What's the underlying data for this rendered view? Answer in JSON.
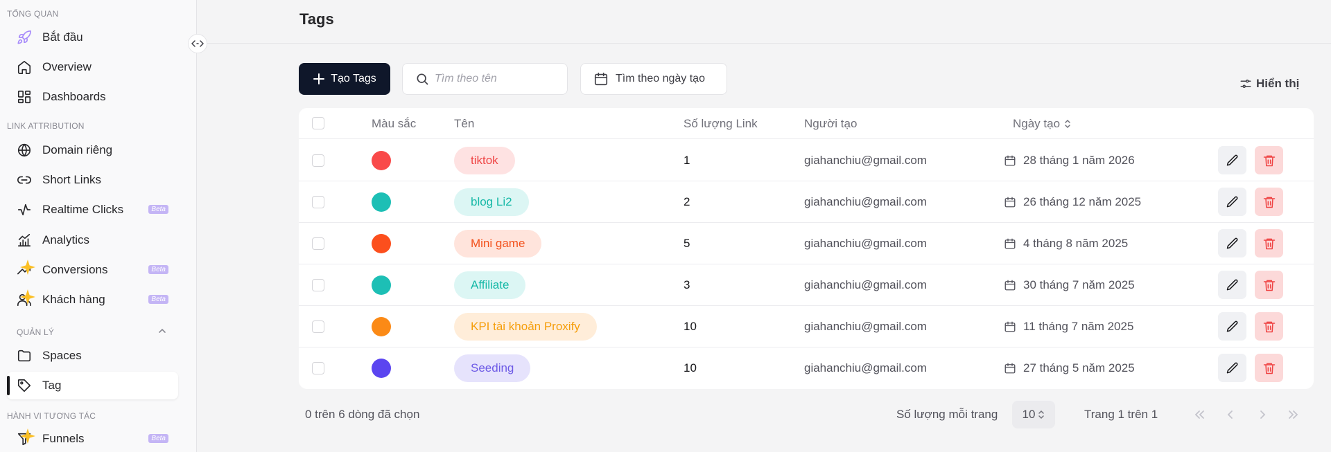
{
  "sidebar": {
    "sections": [
      {
        "label": "TỔNG QUAN"
      },
      {
        "label": "LINK ATTRIBUTION"
      },
      {
        "label": "QUẢN LÝ"
      },
      {
        "label": "HÀNH VI TƯƠNG TÁC"
      }
    ],
    "items": [
      {
        "label": "Bắt đầu",
        "icon": "rocket-icon"
      },
      {
        "label": "Overview",
        "icon": "home-icon"
      },
      {
        "label": "Dashboards",
        "icon": "dashboard-icon"
      },
      {
        "label": "Domain riêng",
        "icon": "globe-icon"
      },
      {
        "label": "Short Links",
        "icon": "link-icon"
      },
      {
        "label": "Realtime Clicks",
        "icon": "activity-icon",
        "badge": "Beta"
      },
      {
        "label": "Analytics",
        "icon": "chart-icon"
      },
      {
        "label": "Conversions",
        "icon": "trending-up-icon",
        "badge": "Beta"
      },
      {
        "label": "Khách hàng",
        "icon": "users-icon",
        "badge": "Beta"
      },
      {
        "label": "Spaces",
        "icon": "folder-icon"
      },
      {
        "label": "Tag",
        "icon": "tag-icon",
        "active": true
      },
      {
        "label": "Funnels",
        "icon": "funnel-icon",
        "badge": "Beta"
      }
    ]
  },
  "header": {
    "title": "Tags"
  },
  "toolbar": {
    "create_label": "Tạo Tags",
    "search_placeholder": "Tìm theo tên",
    "date_filter_label": "Tìm theo ngày tạo",
    "view_label": "Hiển thị"
  },
  "table": {
    "columns": [
      "Màu sắc",
      "Tên",
      "Số lượng Link",
      "Người tạo",
      "Ngày tạo"
    ],
    "rows": [
      {
        "color": "#f94a4a",
        "name": "tiktok",
        "pill_bg": "#fee2e2",
        "pill_fg": "#ef4444",
        "links": "1",
        "creator": "giahanchiu@gmail.com",
        "date": "28 tháng 1 năm 2026"
      },
      {
        "color": "#1dbfb5",
        "name": "blog Li2",
        "pill_bg": "#dcf6f4",
        "pill_fg": "#14b8a6",
        "links": "2",
        "creator": "giahanchiu@gmail.com",
        "date": "26 tháng 12 năm 2025"
      },
      {
        "color": "#fc4f1d",
        "name": "Mini game",
        "pill_bg": "#ffe4dc",
        "pill_fg": "#f2511c",
        "links": "5",
        "creator": "giahanchiu@gmail.com",
        "date": "4 tháng 8 năm 2025"
      },
      {
        "color": "#1dbfb5",
        "name": "Affiliate",
        "pill_bg": "#dcf6f4",
        "pill_fg": "#14b8a6",
        "links": "3",
        "creator": "giahanchiu@gmail.com",
        "date": "30 tháng 7 năm 2025"
      },
      {
        "color": "#fb8a16",
        "name": "KPI tài khoản Proxify",
        "pill_bg": "#ffedd9",
        "pill_fg": "#f59e0b",
        "links": "10",
        "creator": "giahanchiu@gmail.com",
        "date": "11 tháng 7 năm 2025"
      },
      {
        "color": "#5b45f0",
        "name": "Seeding",
        "pill_bg": "#e6e3fc",
        "pill_fg": "#6d5ae6",
        "links": "10",
        "creator": "giahanchiu@gmail.com",
        "date": "27 tháng 5 năm 2025"
      }
    ]
  },
  "footer": {
    "selected_text": "0 trên 6 dòng đã chọn",
    "per_page_label": "Số lượng mỗi trang",
    "per_page_value": "10",
    "page_info": "Trang 1 trên 1"
  }
}
